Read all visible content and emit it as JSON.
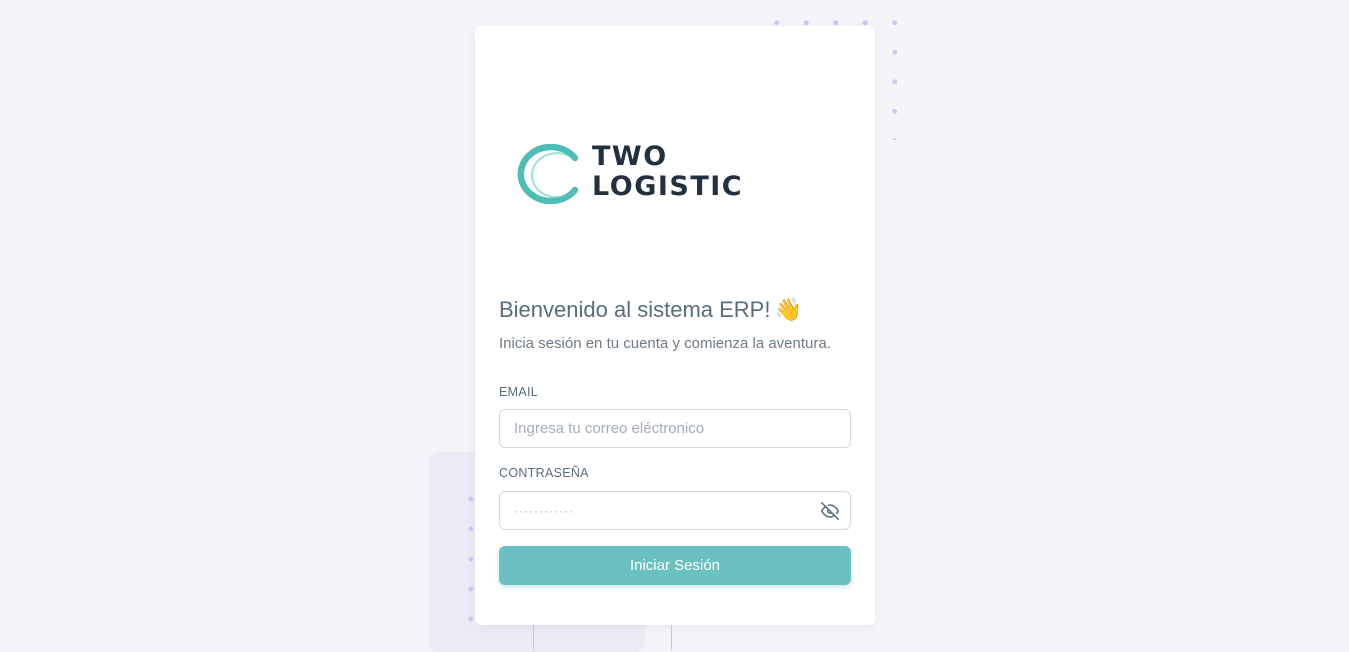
{
  "brand": {
    "line1": "TWO",
    "line2": "LOGISTIC",
    "ring_color": "#4dbdb5",
    "text_color": "#23303f"
  },
  "welcome": {
    "title": "Bienvenido al sistema ERP!",
    "emoji": "👋",
    "subtitle": "Inicia sesión en tu cuenta y comienza la aventura."
  },
  "form": {
    "email_label": "EMAIL",
    "email_placeholder": "Ingresa tu correo eléctronico",
    "email_value": "",
    "password_label": "CONTRASEÑA",
    "password_placeholder": "············",
    "password_value": "",
    "password_toggle_icon": "eye-off-icon",
    "submit_label": "Iniciar Sesión",
    "accent_color": "#6bc1c2"
  }
}
